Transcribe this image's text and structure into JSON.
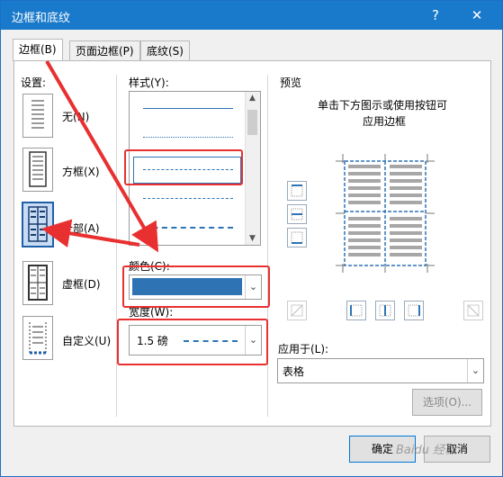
{
  "window": {
    "title": "边框和底纹",
    "help": "?",
    "close": "✕"
  },
  "tabs": [
    {
      "label": "边框(B)",
      "active": true
    },
    {
      "label": "页面边框(P)",
      "active": false
    },
    {
      "label": "底纹(S)",
      "active": false
    }
  ],
  "settings": {
    "heading": "设置:",
    "items": [
      {
        "label": "无(N)",
        "icon": "border-none-icon"
      },
      {
        "label": "方框(X)",
        "icon": "border-box-icon"
      },
      {
        "label": "全部(A)",
        "icon": "border-all-icon",
        "selected": true
      },
      {
        "label": "虚框(D)",
        "icon": "border-grid-icon"
      },
      {
        "label": "自定义(U)",
        "icon": "border-custom-icon"
      }
    ]
  },
  "style": {
    "heading": "样式(Y):",
    "selected_index": 2
  },
  "color": {
    "heading": "颜色(C):",
    "value": "#2e74b5"
  },
  "width": {
    "heading": "宽度(W):",
    "value": "1.5 磅"
  },
  "preview": {
    "heading": "预览",
    "hint_line1": "单击下方图示或使用按钮可",
    "hint_line2": "应用边框",
    "line_color": "#2e74b5"
  },
  "apply_to": {
    "heading": "应用于(L):",
    "value": "表格"
  },
  "buttons": {
    "options": "选项(O)...",
    "ok": "确定",
    "cancel": "取消"
  },
  "watermark": "Baidu 经验"
}
